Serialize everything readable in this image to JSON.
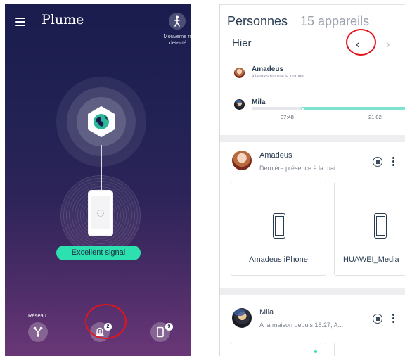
{
  "left": {
    "brand": "Plume",
    "motion_label": "Mouveme nt détecté",
    "signal_status": "Excellent signal",
    "nav": {
      "network_label": "Réseau",
      "security_badge": "2",
      "devices_badge": "9"
    },
    "colors": {
      "accent": "#2de0b0",
      "background_top": "#1a1c4e",
      "background_bottom": "#6a3777",
      "highlight_ring": "#e3141b"
    }
  },
  "right": {
    "title": "Personnes",
    "subtitle": "15 appareils",
    "day": "Hier",
    "prev_icon": "chevron-left-icon",
    "next_icon": "chevron-right-icon",
    "summary": [
      {
        "name": "Amadeus",
        "sub": "à la maison toute la journée"
      },
      {
        "name": "Mila",
        "start": "07:48",
        "end": "21:02"
      }
    ],
    "people": [
      {
        "name": "Amadeus",
        "status": "Dernière présence à la mai...",
        "devices": [
          {
            "name": "Amadeus iPhone"
          },
          {
            "name": "HUAWEI_Media"
          }
        ]
      },
      {
        "name": "Mila",
        "status": "À la maison depuis 18:27, A..."
      }
    ]
  }
}
